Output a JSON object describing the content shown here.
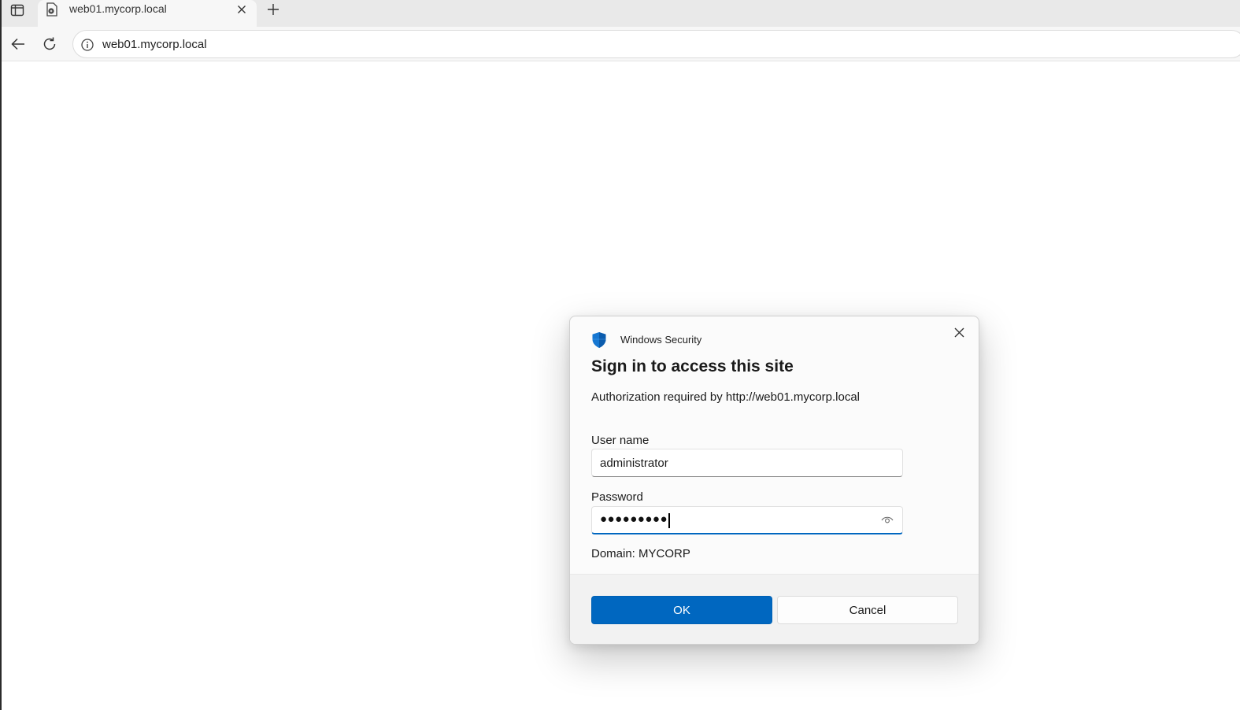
{
  "browser": {
    "tab": {
      "title": "web01.mycorp.local"
    },
    "address": {
      "url": "web01.mycorp.local"
    }
  },
  "dialog": {
    "app_name": "Windows Security",
    "title": "Sign in to access this site",
    "description": "Authorization required by http://web01.mycorp.local",
    "username": {
      "label": "User name",
      "value": "administrator"
    },
    "password": {
      "label": "Password",
      "masked_value": "●●●●●●●●●"
    },
    "domain": "Domain: MYCORP",
    "ok_label": "OK",
    "cancel_label": "Cancel"
  },
  "colors": {
    "accent": "#0067c0",
    "shield": "#1677d2"
  }
}
